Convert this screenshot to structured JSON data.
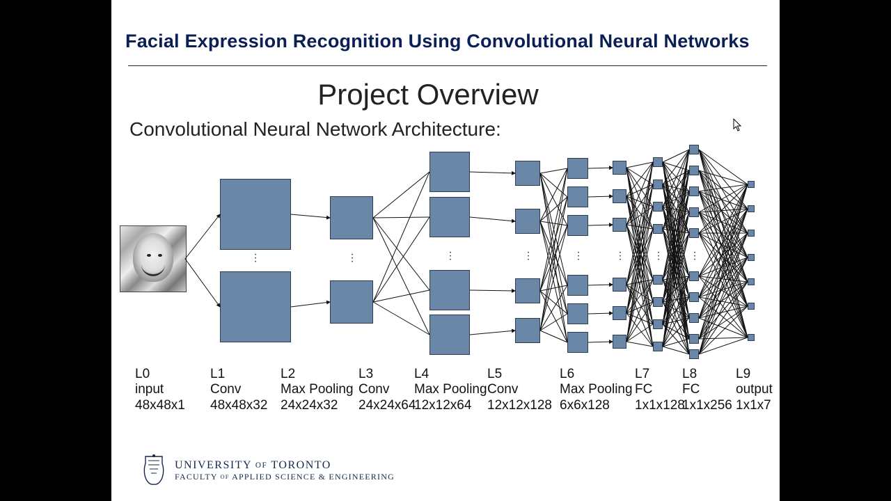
{
  "title": "Facial Expression Recognition Using Convolutional Neural Networks",
  "heading": "Project Overview",
  "subheading": "Convolutional Neural Network Architecture:",
  "layers": [
    {
      "id": "L0",
      "name": "input",
      "dims": "48x48x1"
    },
    {
      "id": "L1",
      "name": "Conv",
      "dims": "48x48x32"
    },
    {
      "id": "L2",
      "name": "Max Pooling",
      "dims": "24x24x32"
    },
    {
      "id": "L3",
      "name": "Conv",
      "dims": "24x24x64"
    },
    {
      "id": "L4",
      "name": "Max Pooling",
      "dims": "12x12x64"
    },
    {
      "id": "L5",
      "name": "Conv",
      "dims": "12x12x128"
    },
    {
      "id": "L6",
      "name": "Max Pooling",
      "dims": "6x6x128"
    },
    {
      "id": "L7",
      "name": "FC",
      "dims": "1x1x128"
    },
    {
      "id": "L8",
      "name": "FC",
      "dims": "1x1x256"
    },
    {
      "id": "L9",
      "name": "output",
      "dims": "1x1x7"
    }
  ],
  "label_x": [
    34,
    142,
    243,
    355,
    435,
    540,
    644,
    752,
    820,
    897
  ],
  "footer": {
    "university": "UNIVERSITY OF TORONTO",
    "faculty": "FACULTY OF APPLIED SCIENCE & ENGINEERING"
  },
  "colors": {
    "title": "#0a1f55",
    "block_fill": "#6a87a8",
    "block_stroke": "#2a3d55"
  }
}
